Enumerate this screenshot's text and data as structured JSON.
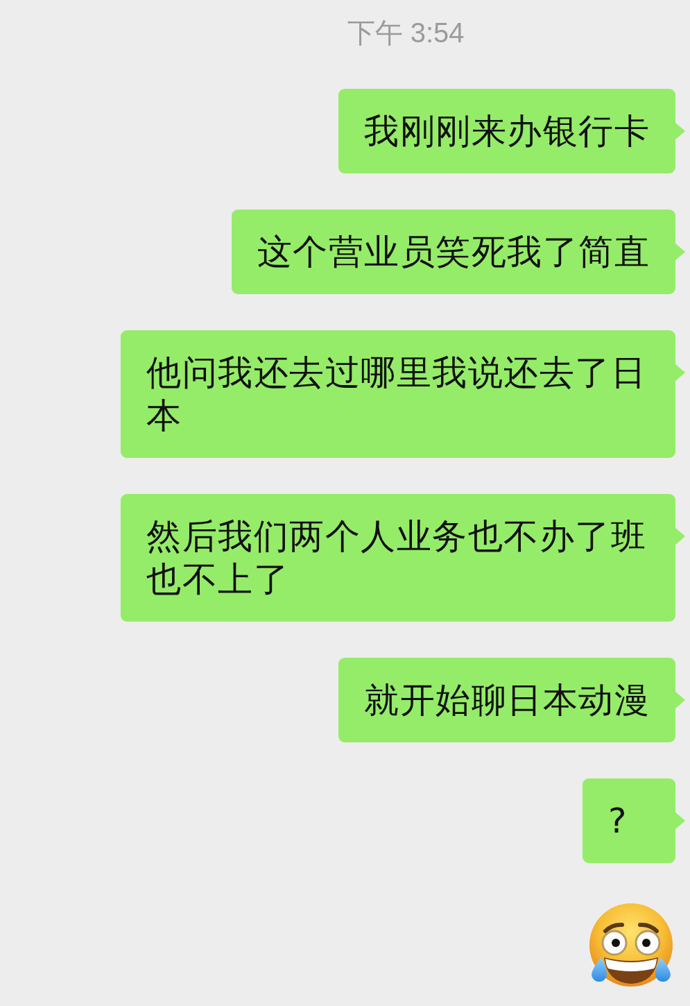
{
  "timestamp": "下午 3:54",
  "messages": [
    {
      "kind": "text",
      "text": "我刚刚来办银行卡"
    },
    {
      "kind": "text",
      "text": "这个营业员笑死我了简直"
    },
    {
      "kind": "text",
      "text": "他问我还去过哪里我说还去了日本"
    },
    {
      "kind": "text",
      "text": "然后我们两个人业务也不办了班也不上了"
    },
    {
      "kind": "text",
      "text": "就开始聊日本动漫"
    },
    {
      "kind": "text",
      "text": "?"
    },
    {
      "kind": "sticker"
    }
  ]
}
